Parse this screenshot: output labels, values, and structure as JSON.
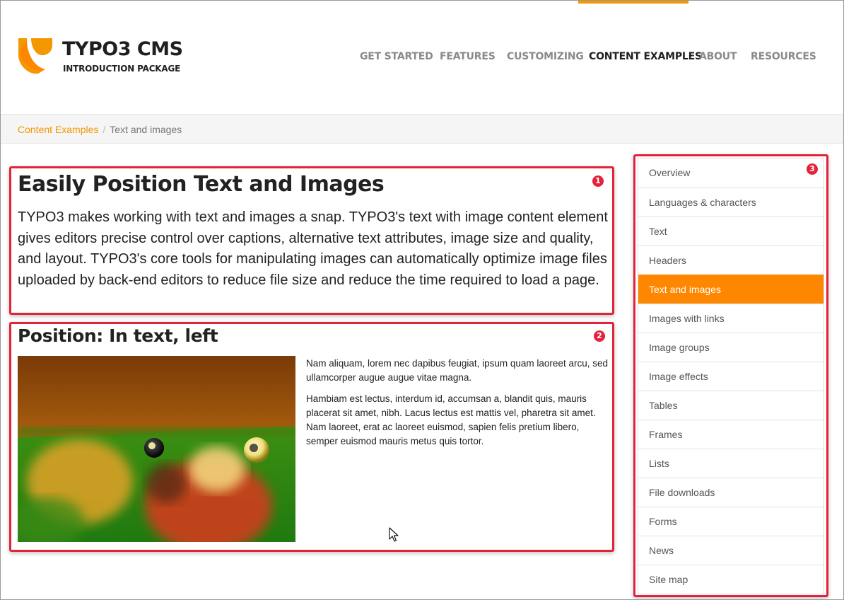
{
  "brand": {
    "title": "TYPO3 CMS",
    "subtitle": "INTRODUCTION PACKAGE",
    "accent_color": "#f49700",
    "logo_icon": "typo3-logo-icon"
  },
  "main_nav": {
    "items": [
      {
        "label": "GET STARTED"
      },
      {
        "label": "FEATURES"
      },
      {
        "label": "CUSTOMIZING"
      },
      {
        "label": "CONTENT EXAMPLES",
        "active": true
      },
      {
        "label": "ABOUT"
      },
      {
        "label": "RESOURCES"
      }
    ]
  },
  "breadcrumb": {
    "parent": "Content Examples",
    "separator": "/",
    "current": "Text and images"
  },
  "annotations": {
    "badge1": "1",
    "badge2": "2",
    "badge3": "3",
    "color": "#e2233a"
  },
  "section1": {
    "heading": "Easily Position Text and Images",
    "body": "TYPO3 makes working with text and images a snap. TYPO3's text with image content element gives editors precise control over captions, alternative text attributes, image size and quality, and layout. TYPO3's core tools for manipulating images can automatically optimize image files uploaded by back-end editors to reduce file size and reduce the time required to load a page."
  },
  "section2": {
    "heading": "Position: In text, left",
    "paragraph1": "Nam aliquam, lorem nec dapibus feugiat, ipsum quam laoreet arcu, sed ullamcorper augue augue vitae magna.",
    "paragraph2": "Hambiam est lectus, interdum id, accumsan a, blandit quis, mauris placerat sit amet, nibh. Lacus lectus est mattis vel, pharetra sit amet. Nam laoreet, erat ac laoreet euismod, sapien felis pretium libero, semper euismod mauris metus quis tortor."
  },
  "sidebar": {
    "items": [
      {
        "label": "Overview"
      },
      {
        "label": "Languages & characters"
      },
      {
        "label": "Text"
      },
      {
        "label": "Headers"
      },
      {
        "label": "Text and images",
        "active": true
      },
      {
        "label": "Images with links"
      },
      {
        "label": "Image groups"
      },
      {
        "label": "Image effects"
      },
      {
        "label": "Tables"
      },
      {
        "label": "Frames"
      },
      {
        "label": "Lists"
      },
      {
        "label": "File downloads"
      },
      {
        "label": "Forms"
      },
      {
        "label": "News"
      },
      {
        "label": "Site map"
      }
    ],
    "active_color": "#ff8700"
  }
}
